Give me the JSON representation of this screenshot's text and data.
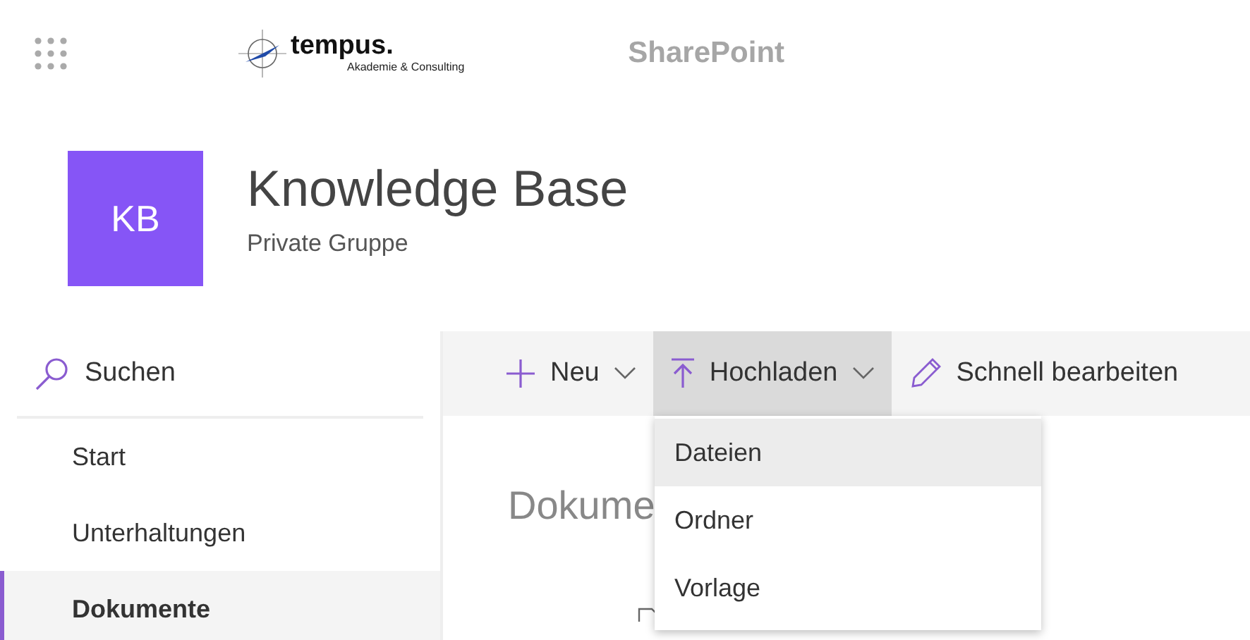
{
  "top_bar": {
    "logo_name": "tempus.",
    "logo_tagline": "Akademie & Consulting",
    "app_name": "SharePoint"
  },
  "site": {
    "initials": "KB",
    "title": "Knowledge Base",
    "subtitle": "Private Gruppe"
  },
  "search": {
    "placeholder": "Suchen"
  },
  "nav": [
    {
      "label": "Start",
      "selected": false
    },
    {
      "label": "Unterhaltungen",
      "selected": false
    },
    {
      "label": "Dokumente",
      "selected": true
    }
  ],
  "toolbar": [
    {
      "kind": "new",
      "label": "Neu",
      "expanded": false
    },
    {
      "kind": "upload",
      "label": "Hochladen",
      "expanded": true
    },
    {
      "kind": "edit",
      "label": "Schnell bearbeiten",
      "expanded": false
    }
  ],
  "upload_menu": [
    {
      "label": "Dateien",
      "hovered": true
    },
    {
      "label": "Ordner",
      "hovered": false
    },
    {
      "label": "Vorlage",
      "hovered": false
    }
  ],
  "content": {
    "heading": "Dokume"
  }
}
